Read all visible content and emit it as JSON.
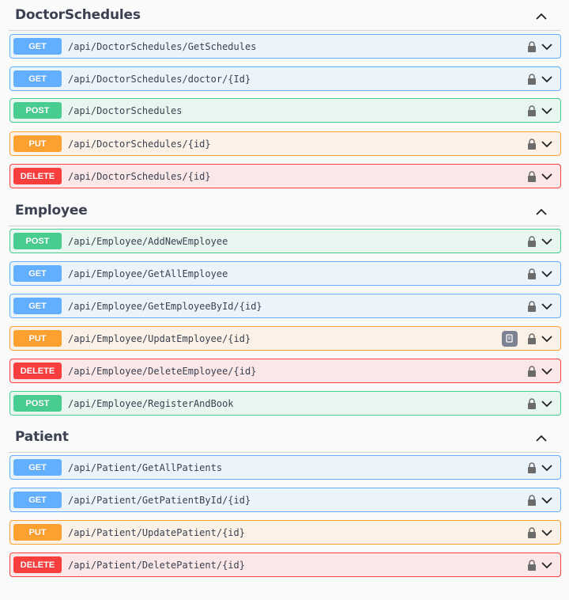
{
  "sections": [
    {
      "title": "DoctorSchedules",
      "operations": [
        {
          "method": "GET",
          "path": "/api/DoctorSchedules/GetSchedules"
        },
        {
          "method": "GET",
          "path": "/api/DoctorSchedules/doctor/{Id}"
        },
        {
          "method": "POST",
          "path": "/api/DoctorSchedules"
        },
        {
          "method": "PUT",
          "path": "/api/DoctorSchedules/{id}"
        },
        {
          "method": "DELETE",
          "path": "/api/DoctorSchedules/{id}"
        }
      ]
    },
    {
      "title": "Employee",
      "operations": [
        {
          "method": "POST",
          "path": "/api/Employee/AddNewEmployee"
        },
        {
          "method": "GET",
          "path": "/api/Employee/GetAllEmployee"
        },
        {
          "method": "GET",
          "path": "/api/Employee/GetEmployeeById/{id}"
        },
        {
          "method": "PUT",
          "path": "/api/Employee/UpdatEmployee/{id}",
          "copy_icon": "copy-icon"
        },
        {
          "method": "DELETE",
          "path": "/api/Employee/DeleteEmployee/{id}"
        },
        {
          "method": "POST",
          "path": "/api/Employee/RegisterAndBook"
        }
      ]
    },
    {
      "title": "Patient",
      "operations": [
        {
          "method": "GET",
          "path": "/api/Patient/GetAllPatients"
        },
        {
          "method": "GET",
          "path": "/api/Patient/GetPatientById/{id}"
        },
        {
          "method": "PUT",
          "path": "/api/Patient/UpdatePatient/{id}"
        },
        {
          "method": "DELETE",
          "path": "/api/Patient/DeletePatient/{id}"
        }
      ]
    }
  ],
  "icons": {
    "lock": "lock-icon",
    "expand": "chevron-down-icon",
    "collapse": "chevron-up-icon",
    "copy": "copy-icon"
  },
  "colors": {
    "get": "#61affe",
    "post": "#49cc90",
    "put": "#fca130",
    "delete": "#f93e3e",
    "text": "#3b4151"
  }
}
